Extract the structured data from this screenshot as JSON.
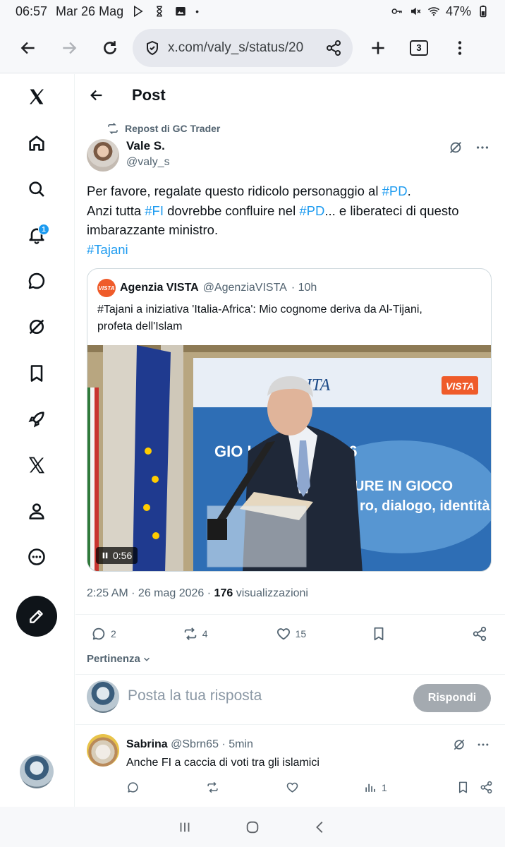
{
  "status_bar": {
    "time": "06:57",
    "date": "Mar 26 Mag",
    "battery": "47%"
  },
  "browser": {
    "url": "x.com/valy_s/status/20",
    "tab_count": "3"
  },
  "nav": {
    "notification_count": "1"
  },
  "header": {
    "title": "Post"
  },
  "repost": {
    "label": "Repost di GC Trader"
  },
  "post": {
    "author_name": "Vale S.",
    "author_handle": "@valy_s",
    "line1_before": "Per favore, regalate questo ridicolo personaggio al ",
    "line1_tag": "#PD",
    "line1_after": ".",
    "line2_a": "Anzi tutta ",
    "line2_tag1": "#FI",
    "line2_b": " dovrebbe confluire nel ",
    "line2_tag2": "#PD",
    "line2_c": "... e liberateci di questo",
    "line3": "imbarazzante ministro.",
    "line4_tag": "#Tajani",
    "time": "2:25 AM · 26 mag 2026",
    "separator": " · ",
    "views_count": "176",
    "views_label": "visualizzazioni"
  },
  "quote": {
    "logo_text": "VISTA",
    "name": "Agenzia VISTA",
    "handle": "@AgenziaVISTA",
    "age": "· 10h",
    "line1": "#Tajani a iniziativa 'Italia-Africa': Mio cognome deriva da Al-Tijani,",
    "line2": "profeta dell'Islam",
    "video_duration": "0:56",
    "video_banner_org": "ITA",
    "video_banner_title": "GIO    L'AFRICA 2026",
    "video_banner_sub1": "URE IN GIOCO",
    "video_banner_sub2": "ro, dialogo, identità",
    "video_logo": "VISTA"
  },
  "actions": {
    "replies": "2",
    "reposts": "4",
    "likes": "15"
  },
  "sort": {
    "label": "Pertinenza"
  },
  "reply": {
    "placeholder": "Posta la tua risposta",
    "button": "Rispondi"
  },
  "comment": {
    "name": "Sabrina",
    "handle": "@Sbrn65",
    "age": "· 5min",
    "text": "Anche FI a caccia di voti tra gli islamici",
    "views": "1"
  },
  "colors": {
    "accent": "#1d9bf0",
    "text": "#0f1419",
    "muted": "#536471"
  }
}
